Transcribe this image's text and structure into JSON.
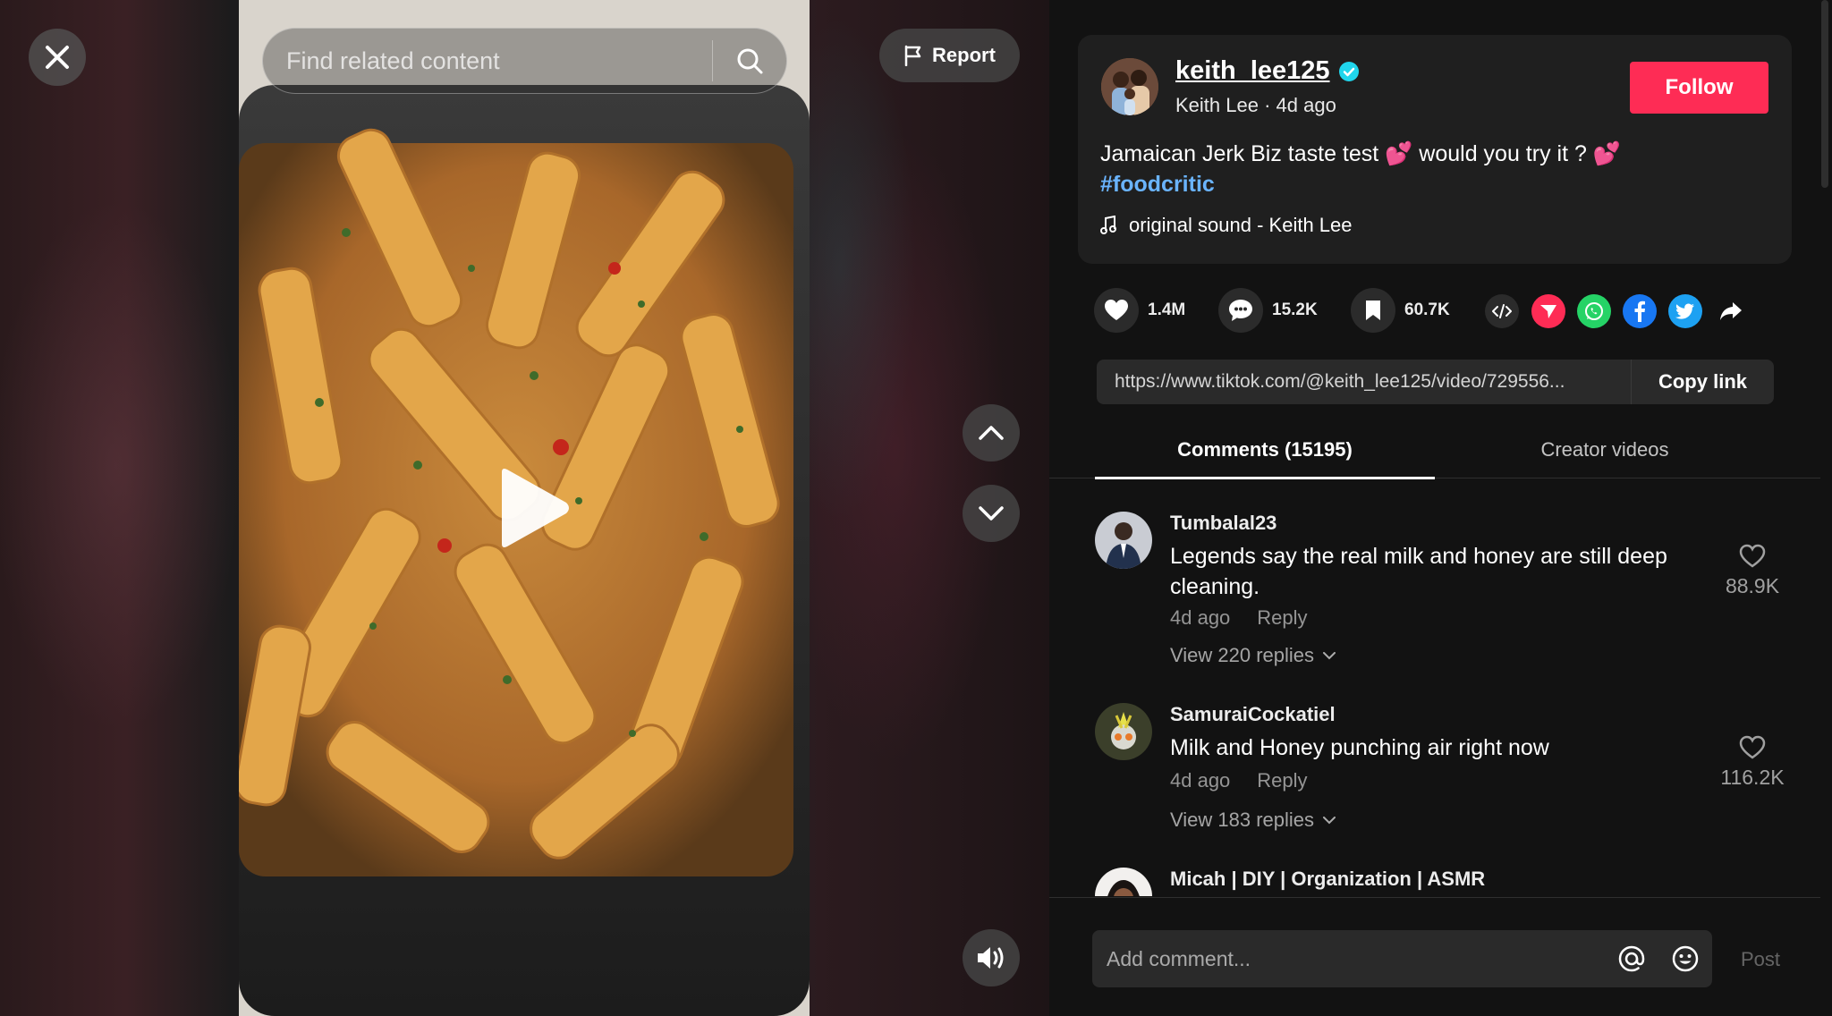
{
  "video": {
    "search_placeholder": "Find related content",
    "report_label": "Report"
  },
  "author": {
    "username": "keith_lee125",
    "display_name": "Keith Lee",
    "posted": "4d ago",
    "follow_label": "Follow"
  },
  "post": {
    "caption_part1": "Jamaican Jerk Biz taste test",
    "caption_emoji1": "💕",
    "caption_part2": "would you try it ?",
    "caption_emoji2": "💕",
    "hashtag": "#foodcritic",
    "sound": "original sound - Keith Lee"
  },
  "stats": {
    "likes": "1.4M",
    "comments": "15.2K",
    "saves": "60.7K"
  },
  "share": {
    "link": "https://www.tiktok.com/@keith_lee125/video/729556...",
    "copy_label": "Copy link"
  },
  "tabs": [
    {
      "label": "Comments (15195)"
    },
    {
      "label": "Creator videos"
    }
  ],
  "comments": [
    {
      "user": "Tumbalal23",
      "text": "Legends say the real milk and honey are still deep cleaning.",
      "time": "4d ago",
      "reply_label": "Reply",
      "replies": "View 220 replies",
      "likes": "88.9K"
    },
    {
      "user": "SamuraiCockatiel",
      "text": "Milk and Honey punching air right now",
      "time": "4d ago",
      "reply_label": "Reply",
      "replies": "View 183 replies",
      "likes": "116.2K"
    },
    {
      "user": "Micah | DIY | Organization | ASMR"
    }
  ],
  "composer": {
    "placeholder": "Add comment...",
    "post_label": "Post"
  },
  "colors": {
    "follow": "#fe2c55",
    "hashtag": "#6ab4ff",
    "verified": "#20d5ec",
    "panel_bg": "#121212",
    "card_bg": "#1f1f1f"
  },
  "icons": [
    "close-icon",
    "search-icon",
    "flag-icon",
    "play-icon",
    "chevron-up-icon",
    "chevron-down-icon",
    "volume-icon",
    "verified-icon",
    "music-note-icon",
    "heart-icon",
    "comment-icon",
    "bookmark-icon",
    "embed-icon",
    "telegram-icon",
    "whatsapp-icon",
    "facebook-icon",
    "twitter-icon",
    "share-arrow-icon",
    "at-icon",
    "emoji-icon"
  ]
}
